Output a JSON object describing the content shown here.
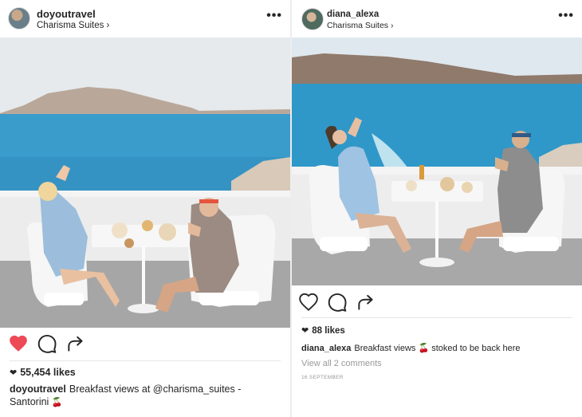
{
  "posts": [
    {
      "username": "doyoutravel",
      "location": "Charisma Suites ›",
      "more_icon": "ellipsis-icon",
      "liked": true,
      "likes": "55,454 likes",
      "caption_user": "doyoutravel",
      "caption_text": "Breakfast views at @charisma_suites - Santorini",
      "caption_emoji": "🍒"
    },
    {
      "username": "diana_alexa",
      "location": "Charisma Suites ›",
      "more_icon": "ellipsis-icon",
      "liked": false,
      "likes": "88 likes",
      "caption_user": "diana_alexa",
      "caption_text": "Breakfast views",
      "caption_emoji": "🍒",
      "caption_text_after": "stoked to be back here",
      "comments_link": "View all 2 comments",
      "date": "16 SEPTEMBER"
    }
  ],
  "colors": {
    "like_red": "#ed4956",
    "sea": "#2f9cc4",
    "sky": "#e9eef1"
  }
}
